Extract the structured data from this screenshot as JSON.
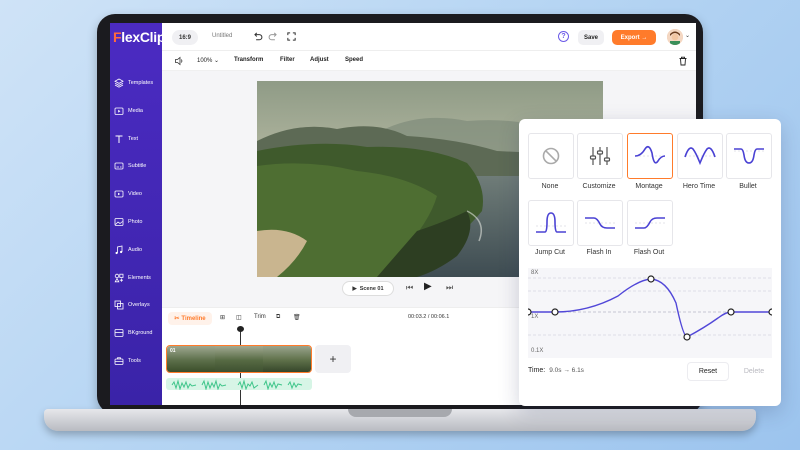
{
  "app": {
    "brand": "FlexClip",
    "brand_first_letter": "F",
    "brand_rest": "lexClip"
  },
  "sidebar": {
    "items": [
      {
        "label": "Templates",
        "icon": "layers-icon"
      },
      {
        "label": "Media",
        "icon": "folder-icon"
      },
      {
        "label": "Text",
        "icon": "text-icon"
      },
      {
        "label": "Subtitle",
        "icon": "subtitle-icon"
      },
      {
        "label": "Video",
        "icon": "video-icon"
      },
      {
        "label": "Photo",
        "icon": "photo-icon"
      },
      {
        "label": "Audio",
        "icon": "audio-icon"
      },
      {
        "label": "Elements",
        "icon": "elements-icon"
      },
      {
        "label": "Overlays",
        "icon": "overlays-icon"
      },
      {
        "label": "BKground",
        "icon": "background-icon"
      },
      {
        "label": "Tools",
        "icon": "tools-icon"
      }
    ]
  },
  "topbar": {
    "aspect_ratio": "16:9",
    "project_title": "Untitled",
    "save_label": "Save",
    "export_label": "Export →"
  },
  "toolbar": {
    "zoom": "100%",
    "transform": "Transform",
    "filter": "Filter",
    "adjust": "Adjust",
    "speed": "Speed"
  },
  "canvas": {
    "scene_label": "Scene 01"
  },
  "timeline": {
    "button_label": "Timeline",
    "trim_label": "Trim",
    "time_readout": "00:03.2 / 00:06.1",
    "clip_label": "01",
    "add_label": "+"
  },
  "speed_panel": {
    "presets": [
      {
        "label": "None",
        "icon": "none-icon"
      },
      {
        "label": "Customize",
        "icon": "customize-icon"
      },
      {
        "label": "Montage",
        "icon": "montage-curve-icon",
        "selected": true
      },
      {
        "label": "Hero Time",
        "icon": "hero-time-curve-icon"
      },
      {
        "label": "Bullet",
        "icon": "bullet-curve-icon"
      },
      {
        "label": "Jump Cut",
        "icon": "jump-cut-curve-icon"
      },
      {
        "label": "Flash In",
        "icon": "flash-in-curve-icon"
      },
      {
        "label": "Flash Out",
        "icon": "flash-out-curve-icon"
      }
    ],
    "graph": {
      "y_top": "8X",
      "y_mid": "1X",
      "y_bottom": "0.1X"
    },
    "time_label": "Time:",
    "time_value": "9.0s → 6.1s",
    "reset_label": "Reset",
    "delete_label": "Delete"
  },
  "colors": {
    "sidebar": "#4b2bc2",
    "accent_orange": "#ff7b2b",
    "curve_blue": "#5147d8"
  }
}
